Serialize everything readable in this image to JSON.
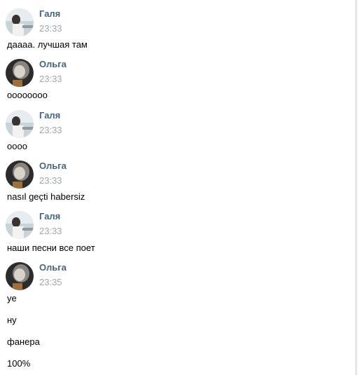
{
  "messages": [
    {
      "author": "Галя",
      "time": "23:33",
      "avatar": "galya-avatar",
      "lines": [
        "даааа. лучшая там"
      ]
    },
    {
      "author": "Ольга",
      "time": "23:33",
      "avatar": "olga-avatar",
      "lines": [
        "оооооооо"
      ]
    },
    {
      "author": "Галя",
      "time": "23:33",
      "avatar": "galya-avatar",
      "lines": [
        "оооо"
      ]
    },
    {
      "author": "Ольга",
      "time": "23:33",
      "avatar": "olga-avatar",
      "lines": [
        "nasıl geçti habersiz"
      ]
    },
    {
      "author": "Галя",
      "time": "23:33",
      "avatar": "galya-avatar",
      "lines": [
        "наши песни все поет"
      ]
    },
    {
      "author": "Ольга",
      "time": "23:35",
      "avatar": "olga-avatar",
      "lines": [
        "ye",
        "ну",
        "фанера",
        "100%"
      ]
    }
  ],
  "colors": {
    "author": "#42648b",
    "time": "#a0a8b2",
    "text": "#000000"
  }
}
